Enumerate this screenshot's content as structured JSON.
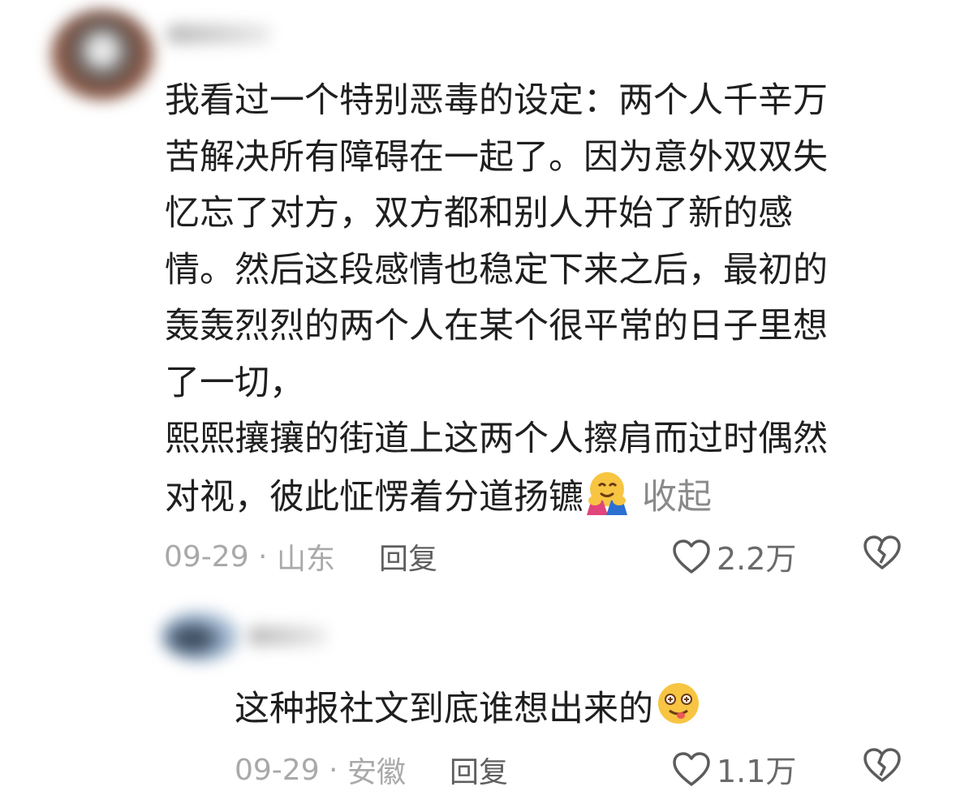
{
  "comments": [
    {
      "text": "我看过一个特别恶毒的设定：两个人千辛万\n苦解决所有障碍在一起了。因为意外双双失\n忆忘了对方，双方都和别人开始了新的感\n情。然后这段感情也稳定下来之后，最初的\n轰轰烈烈的两个人在某个很平常的日子里想\n了一切，\n熙熙攘攘的街道上这两个人擦肩而过时偶然\n对视，彼此怔愣着分道扬镳",
      "emoji": "hugging-face-emoji",
      "collapse_label": "收起",
      "date": "09-29",
      "separator": " · ",
      "location": "山东",
      "reply_label": "回复",
      "like_count": "2.2万"
    },
    {
      "text": "这种报社文到底谁想出来的",
      "emoji": "woozy-face-emoji",
      "date": "09-29",
      "separator": " · ",
      "location": "安徽",
      "reply_label": "回复",
      "like_count": "1.1万"
    }
  ],
  "icons": {
    "like": "heart-outline-icon",
    "dislike": "broken-heart-icon"
  },
  "colors": {
    "text": "#1f1f1f",
    "meta": "#a9a9a9",
    "reply": "#5f5f5f",
    "icon": "#5c5c5c",
    "collapse": "#8a8a8a"
  }
}
